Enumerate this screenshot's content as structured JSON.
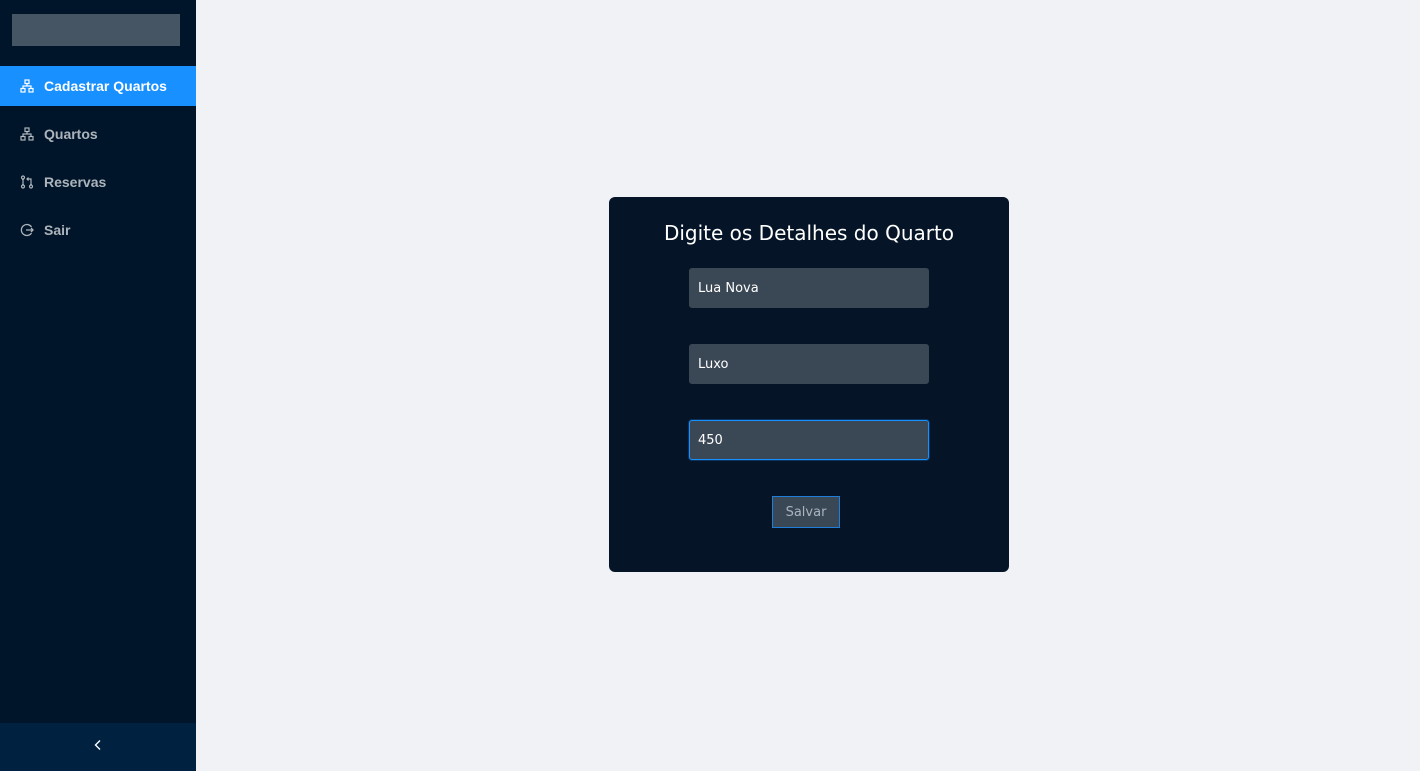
{
  "sidebar": {
    "items": [
      {
        "label": "Cadastrar Quartos",
        "icon": "cluster-icon",
        "active": true
      },
      {
        "label": "Quartos",
        "icon": "cluster-icon",
        "active": false
      },
      {
        "label": "Reservas",
        "icon": "pull-request-icon",
        "active": false
      },
      {
        "label": "Sair",
        "icon": "logout-icon",
        "active": false
      }
    ],
    "collapse_icon": "chevron-left-icon"
  },
  "form": {
    "title": "Digite os Detalhes do Quarto",
    "fields": [
      {
        "value": "Lua Nova"
      },
      {
        "value": "Luxo"
      },
      {
        "value": "450"
      }
    ],
    "save_label": "Salvar"
  },
  "colors": {
    "sidebar_bg": "#001529",
    "active_item": "#1890ff",
    "card_bg": "#051527",
    "page_bg": "#f0f2f5"
  }
}
